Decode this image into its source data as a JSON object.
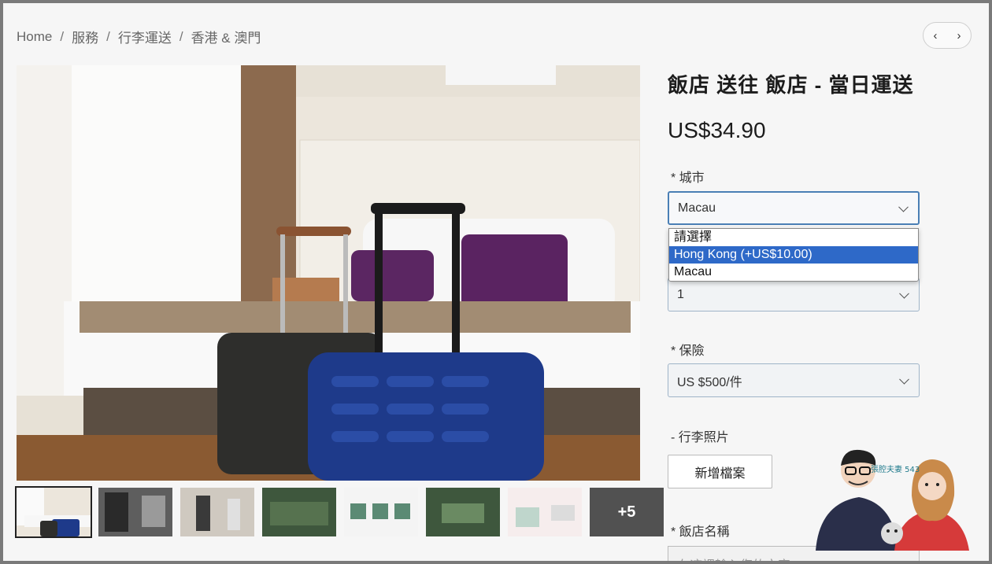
{
  "breadcrumb": {
    "home": "Home",
    "services": "服務",
    "luggage": "行李運送",
    "region": "香港 & 澳門",
    "separator": "/"
  },
  "nav": {
    "prev": "‹",
    "next": "›"
  },
  "product": {
    "title": "飯店 送往 飯店 - 當日運送",
    "price": "US$34.90"
  },
  "form": {
    "city": {
      "label": "* 城市",
      "value": "Macau",
      "options": [
        "請選擇",
        "Hong Kong (+US$10.00)",
        "Macau"
      ],
      "highlighted_option": "Hong Kong (+US$10.00)"
    },
    "quantity": {
      "value": "1"
    },
    "insurance": {
      "label": "* 保險",
      "value": "US $500/件"
    },
    "photos": {
      "label": "- 行李照片",
      "button": "新增檔案"
    },
    "hotel_name": {
      "label": "* 飯店名稱",
      "placeholder": "在這裡輸入您的文字..."
    }
  },
  "thumbnails": {
    "more_label": "+5"
  },
  "watermark": {
    "text": "張腔夫妻 543"
  },
  "colors": {
    "highlight": "#2e69c8",
    "focus_border": "#4a7fb5"
  }
}
